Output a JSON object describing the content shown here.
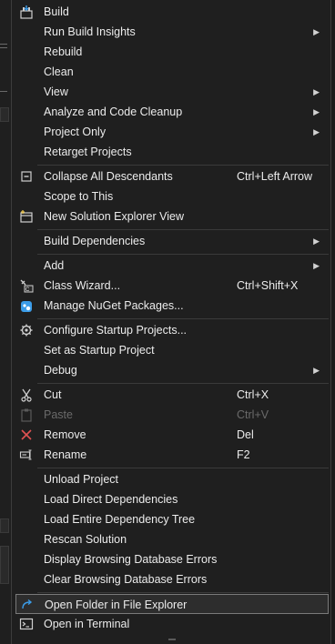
{
  "menu": {
    "items": [
      {
        "label": "Build",
        "icon": "build-icon"
      },
      {
        "label": "Run Build Insights",
        "submenu": true
      },
      {
        "label": "Rebuild"
      },
      {
        "label": "Clean"
      },
      {
        "label": "View",
        "submenu": true
      },
      {
        "label": "Analyze and Code Cleanup",
        "submenu": true
      },
      {
        "label": "Project Only",
        "submenu": true
      },
      {
        "label": "Retarget Projects"
      },
      {
        "label": "Collapse All Descendants",
        "shortcut": "Ctrl+Left Arrow",
        "icon": "collapse-icon"
      },
      {
        "label": "Scope to This"
      },
      {
        "label": "New Solution Explorer View",
        "icon": "new-view-icon"
      },
      {
        "label": "Build Dependencies",
        "submenu": true
      },
      {
        "label": "Add",
        "submenu": true
      },
      {
        "label": "Class Wizard...",
        "shortcut": "Ctrl+Shift+X",
        "icon": "class-wizard-icon"
      },
      {
        "label": "Manage NuGet Packages...",
        "icon": "nuget-icon"
      },
      {
        "label": "Configure Startup Projects...",
        "icon": "gear-icon"
      },
      {
        "label": "Set as Startup Project"
      },
      {
        "label": "Debug",
        "submenu": true
      },
      {
        "label": "Cut",
        "shortcut": "Ctrl+X",
        "icon": "scissors-icon"
      },
      {
        "label": "Paste",
        "shortcut": "Ctrl+V",
        "icon": "paste-icon",
        "disabled": true
      },
      {
        "label": "Remove",
        "shortcut": "Del",
        "icon": "remove-icon"
      },
      {
        "label": "Rename",
        "shortcut": "F2",
        "icon": "rename-icon"
      },
      {
        "label": "Unload Project"
      },
      {
        "label": "Load Direct Dependencies"
      },
      {
        "label": "Load Entire Dependency Tree"
      },
      {
        "label": "Rescan Solution"
      },
      {
        "label": "Display Browsing Database Errors"
      },
      {
        "label": "Clear Browsing Database Errors"
      },
      {
        "label": "Open Folder in File Explorer",
        "icon": "open-folder-icon",
        "highlighted": true
      },
      {
        "label": "Open in Terminal",
        "icon": "terminal-icon"
      }
    ]
  },
  "colors": {
    "menu_bg": "#1f1f1f",
    "text": "#ececec",
    "disabled_text": "#6a6a6a",
    "separator": "#3a3a3a",
    "highlight_border": "#7a7a7a",
    "accent_blue": "#3b9ce8",
    "remove_red": "#e05252"
  }
}
